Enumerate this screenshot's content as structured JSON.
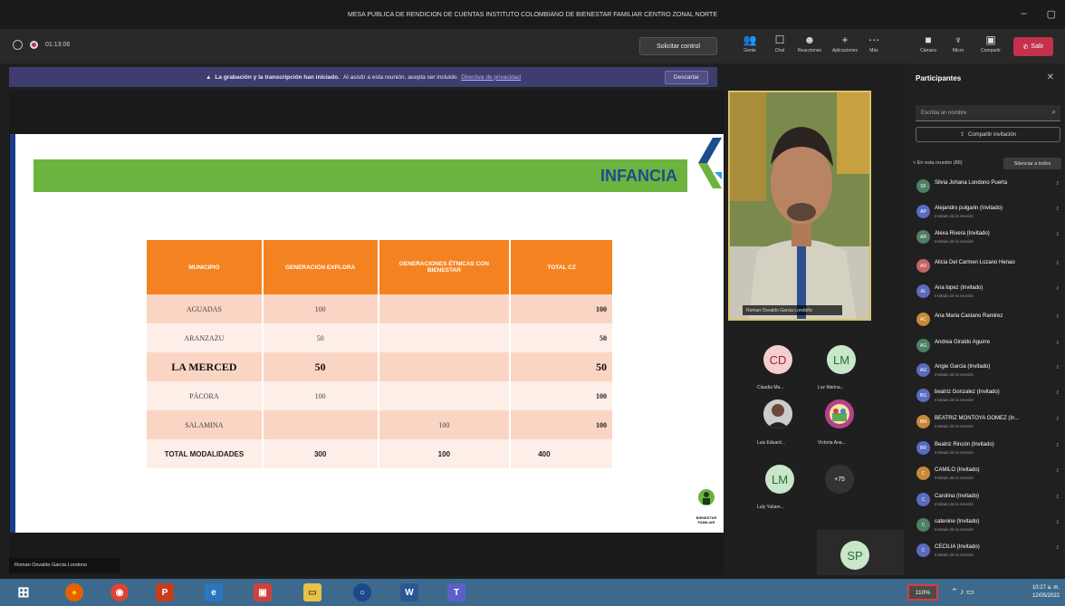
{
  "window": {
    "title": "MESA PUBLICA DE RENDICION DE CUENTAS INSTITUTO COLOMBIANO DE BIENESTAR FAMILIAR CENTRO ZONAL NORTE",
    "minimize": "–",
    "maximize": "▢"
  },
  "toolbar": {
    "timer": "01:13:06",
    "control_label": "Solicitar control",
    "items": [
      {
        "label": "Gente",
        "icon": "people-icon"
      },
      {
        "label": "Chat",
        "icon": "chat-icon"
      },
      {
        "label": "Reacciones",
        "icon": "reactions-icon"
      },
      {
        "label": "Aplicaciones",
        "icon": "apps-icon"
      },
      {
        "label": "Más",
        "icon": "more-icon"
      },
      {
        "label": "Cámara",
        "icon": "camera-icon"
      },
      {
        "label": "Micro",
        "icon": "mic-icon"
      },
      {
        "label": "Compartir",
        "icon": "share-icon"
      }
    ],
    "leave_label": "Salir"
  },
  "banner": {
    "bold": "La grabación y la transcripción han iniciado.",
    "text": "Al asistir a esta reunión, acepta ser incluido.",
    "link": "Directiva de privacidad",
    "dismiss": "Descartar"
  },
  "slide": {
    "title": "INFANCIA",
    "logo_text": "BIENESTAR FAMILIAR",
    "headers": [
      "MUNICIPIO",
      "GENERACIÓN EXPLORA",
      "GENERACIONES ÉTNICAS CON BIENESTAR",
      "TOTAL CZ"
    ],
    "rows": [
      [
        "AGUADAS",
        "100",
        "",
        "100"
      ],
      [
        "ARANZAZU",
        "50",
        "",
        "50"
      ],
      [
        "LA MERCED",
        "50",
        "",
        "50"
      ],
      [
        "PÁCORA",
        "100",
        "",
        "100"
      ],
      [
        "SALAMINA",
        "",
        "100",
        "100"
      ]
    ],
    "total_row": [
      "TOTAL MODALIDADES",
      "300",
      "100",
      "400"
    ]
  },
  "presenter": {
    "caption": "Roman Osvaldo Garcia Londono",
    "video_caption": "Roman Osvaldo Garcia Londoño"
  },
  "gallery": [
    {
      "initials": "CD",
      "name": "Claudia Ma...",
      "color": "#f3cfd2",
      "text_color": "#a4262c"
    },
    {
      "initials": "LM",
      "name": "Luz Marina...",
      "color": "#c8e6c9",
      "text_color": "#2e6b33"
    },
    {
      "initials": "",
      "name": "Luis Eduard...",
      "color": "#888888",
      "text_color": "#fff"
    },
    {
      "initials": "",
      "name": "Victoria Ana...",
      "color": "#b6418b",
      "text_color": "#fff"
    },
    {
      "initials": "LM",
      "name": "Luly Yuliam...",
      "color": "#c8e6c9",
      "text_color": "#2e6b33"
    },
    {
      "initials": "+75",
      "name": "",
      "color": "#333333",
      "text_color": "#fff"
    },
    {
      "initials": "SP",
      "name": "",
      "color": "#c8e6c9",
      "text_color": "#2e6b33"
    }
  ],
  "panel": {
    "title": "Participantes",
    "search_placeholder": "Escriba un nombre",
    "share_invite": "Compartir invitación",
    "in_meeting": "En esta reunión (86)",
    "mute_all": "Silenciar a todos",
    "participants": [
      {
        "initials": "SF",
        "name": "Silvia Johana Londono Puerta",
        "sub": "",
        "color": "#4f7f64"
      },
      {
        "initials": "AP",
        "name": "Alejandro pulgarin (Invitado)",
        "sub": "Invitado de la reunión",
        "color": "#5b6bc0"
      },
      {
        "initials": "AR",
        "name": "Alexa Rivera (Invitado)",
        "sub": "Invitado de la reunión",
        "color": "#4f7f64"
      },
      {
        "initials": "AD",
        "name": "Alicia Del Carmen Lozano Henao",
        "sub": "",
        "color": "#c26464"
      },
      {
        "initials": "AL",
        "name": "Ana lopez (Invitado)",
        "sub": "Invitado de la reunión",
        "color": "#5b6bc0"
      },
      {
        "initials": "AC",
        "name": "Ana Maria Castano Ramirez",
        "sub": "",
        "color": "#c7883a"
      },
      {
        "initials": "AG",
        "name": "Andrea Giraldo Aguirre",
        "sub": "",
        "color": "#4f7f64"
      },
      {
        "initials": "AG",
        "name": "Angie Garcia (Invitado)",
        "sub": "Invitado de la reunión",
        "color": "#5b6bc0"
      },
      {
        "initials": "BG",
        "name": "beatriz Gonzalez (Invitado)",
        "sub": "Invitado de la reunión",
        "color": "#5b6bc0"
      },
      {
        "initials": "BM",
        "name": "BEATRIZ MONTOYA GOMEZ (In...",
        "sub": "Invitado de la reunión",
        "color": "#c7883a"
      },
      {
        "initials": "BR",
        "name": "Beatriz Rincón (Invitado)",
        "sub": "Invitado de la reunión",
        "color": "#5b6bc0"
      },
      {
        "initials": "C",
        "name": "CAMILO (Invitado)",
        "sub": "Invitado de la reunión",
        "color": "#c7883a"
      },
      {
        "initials": "C",
        "name": "Carolina (Invitado)",
        "sub": "Invitado de la reunión",
        "color": "#5b6bc0"
      },
      {
        "initials": "C",
        "name": "catenine (Invitado)",
        "sub": "Invitado de la reunión",
        "color": "#4f7f64"
      },
      {
        "initials": "C",
        "name": "CECILIA (Invitado)",
        "sub": "Invitado de la reunión",
        "color": "#5b6bc0"
      }
    ]
  },
  "taskbar": {
    "apps": [
      {
        "icon": "windows-start-icon",
        "glyph": "⊞",
        "bg": "transparent",
        "fg": "#ffffff"
      },
      {
        "icon": "firefox-icon",
        "glyph": "●",
        "bg": "#e66000",
        "fg": "#ffcb00"
      },
      {
        "icon": "chrome-icon",
        "glyph": "◉",
        "bg": "#db4437",
        "fg": "#ffffff"
      },
      {
        "icon": "powerpoint-icon",
        "glyph": "P",
        "bg": "#c43e1c",
        "fg": "#ffffff"
      },
      {
        "icon": "edge-icon",
        "glyph": "e",
        "bg": "#2a76c2",
        "fg": "#ffffff"
      },
      {
        "icon": "media-icon",
        "glyph": "▣",
        "bg": "#d04040",
        "fg": "#ffffff"
      },
      {
        "icon": "file-explorer-icon",
        "glyph": "▭",
        "bg": "#e7c14a",
        "fg": "#5a4a10"
      },
      {
        "icon": "cortana-icon",
        "glyph": "○",
        "bg": "#1a4a8a",
        "fg": "#ffffff"
      },
      {
        "icon": "word-icon",
        "glyph": "W",
        "bg": "#2b5797",
        "fg": "#ffffff"
      },
      {
        "icon": "teams-icon",
        "glyph": "T",
        "bg": "#5b5fc7",
        "fg": "#ffffff"
      }
    ],
    "zoom": "110%",
    "time": "10:27 a. m.",
    "date": "12/05/2022"
  }
}
